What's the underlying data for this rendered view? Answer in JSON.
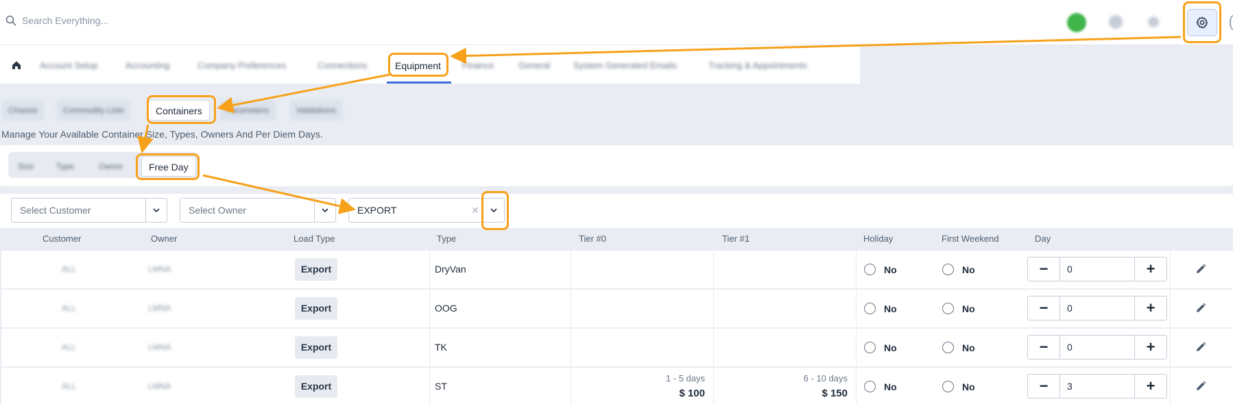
{
  "search": {
    "placeholder": "Search Everything..."
  },
  "main_tabs": {
    "items": [
      {
        "label": "Account Setup"
      },
      {
        "label": "Accounting"
      },
      {
        "label": "Company Preferences"
      },
      {
        "label": "Connections"
      },
      {
        "label": "Equipment"
      },
      {
        "label": "Finance"
      },
      {
        "label": "General"
      },
      {
        "label": "System Generated Emails"
      },
      {
        "label": "Tracking & Appointments"
      }
    ]
  },
  "sub_tabs": {
    "items": [
      {
        "label": "Chassis"
      },
      {
        "label": "Commodity Lists"
      },
      {
        "label": "Containers"
      },
      {
        "label": "Parameters"
      },
      {
        "label": "Validations"
      }
    ]
  },
  "description": "Manage Your Available Container Size, Types, Owners And Per Diem Days.",
  "container_tabs": {
    "items": [
      {
        "label": "Size"
      },
      {
        "label": "Type"
      },
      {
        "label": "Owner"
      },
      {
        "label": "Free Day"
      }
    ]
  },
  "filters": {
    "customer_placeholder": "Select Customer",
    "owner_placeholder": "Select Owner",
    "load_type_value": "EXPORT",
    "clear_symbol": "×"
  },
  "table": {
    "headers": [
      "Customer",
      "Owner",
      "Load Type",
      "Type",
      "Tier #0",
      "Tier #1",
      "Holiday",
      "First Weekend",
      "Day"
    ],
    "rows": [
      {
        "customer": "ALL",
        "owner": "LMNA",
        "load_type": "Export",
        "type": "DryVan",
        "tier0_days": "",
        "tier0_amount": "",
        "tier1_days": "",
        "tier1_amount": "",
        "holiday": "No",
        "first_weekend": "No",
        "day": "0"
      },
      {
        "customer": "ALL",
        "owner": "LMNA",
        "load_type": "Export",
        "type": "OOG",
        "tier0_days": "",
        "tier0_amount": "",
        "tier1_days": "",
        "tier1_amount": "",
        "holiday": "No",
        "first_weekend": "No",
        "day": "0"
      },
      {
        "customer": "ALL",
        "owner": "LMNA",
        "load_type": "Export",
        "type": "TK",
        "tier0_days": "",
        "tier0_amount": "",
        "tier1_days": "",
        "tier1_amount": "",
        "holiday": "No",
        "first_weekend": "No",
        "day": "0"
      },
      {
        "customer": "ALL",
        "owner": "LMNA",
        "load_type": "Export",
        "type": "ST",
        "tier0_days": "1 - 5 days",
        "tier0_amount": "$ 100",
        "tier1_days": "6 - 10 days",
        "tier1_amount": "$ 150",
        "holiday": "No",
        "first_weekend": "No",
        "day": "3"
      }
    ],
    "minus_symbol": "−",
    "plus_symbol": "+"
  },
  "colors": {
    "accent": "#3a6bd8",
    "annotation": "#f7a11a",
    "avatar": "#3fb54a"
  }
}
